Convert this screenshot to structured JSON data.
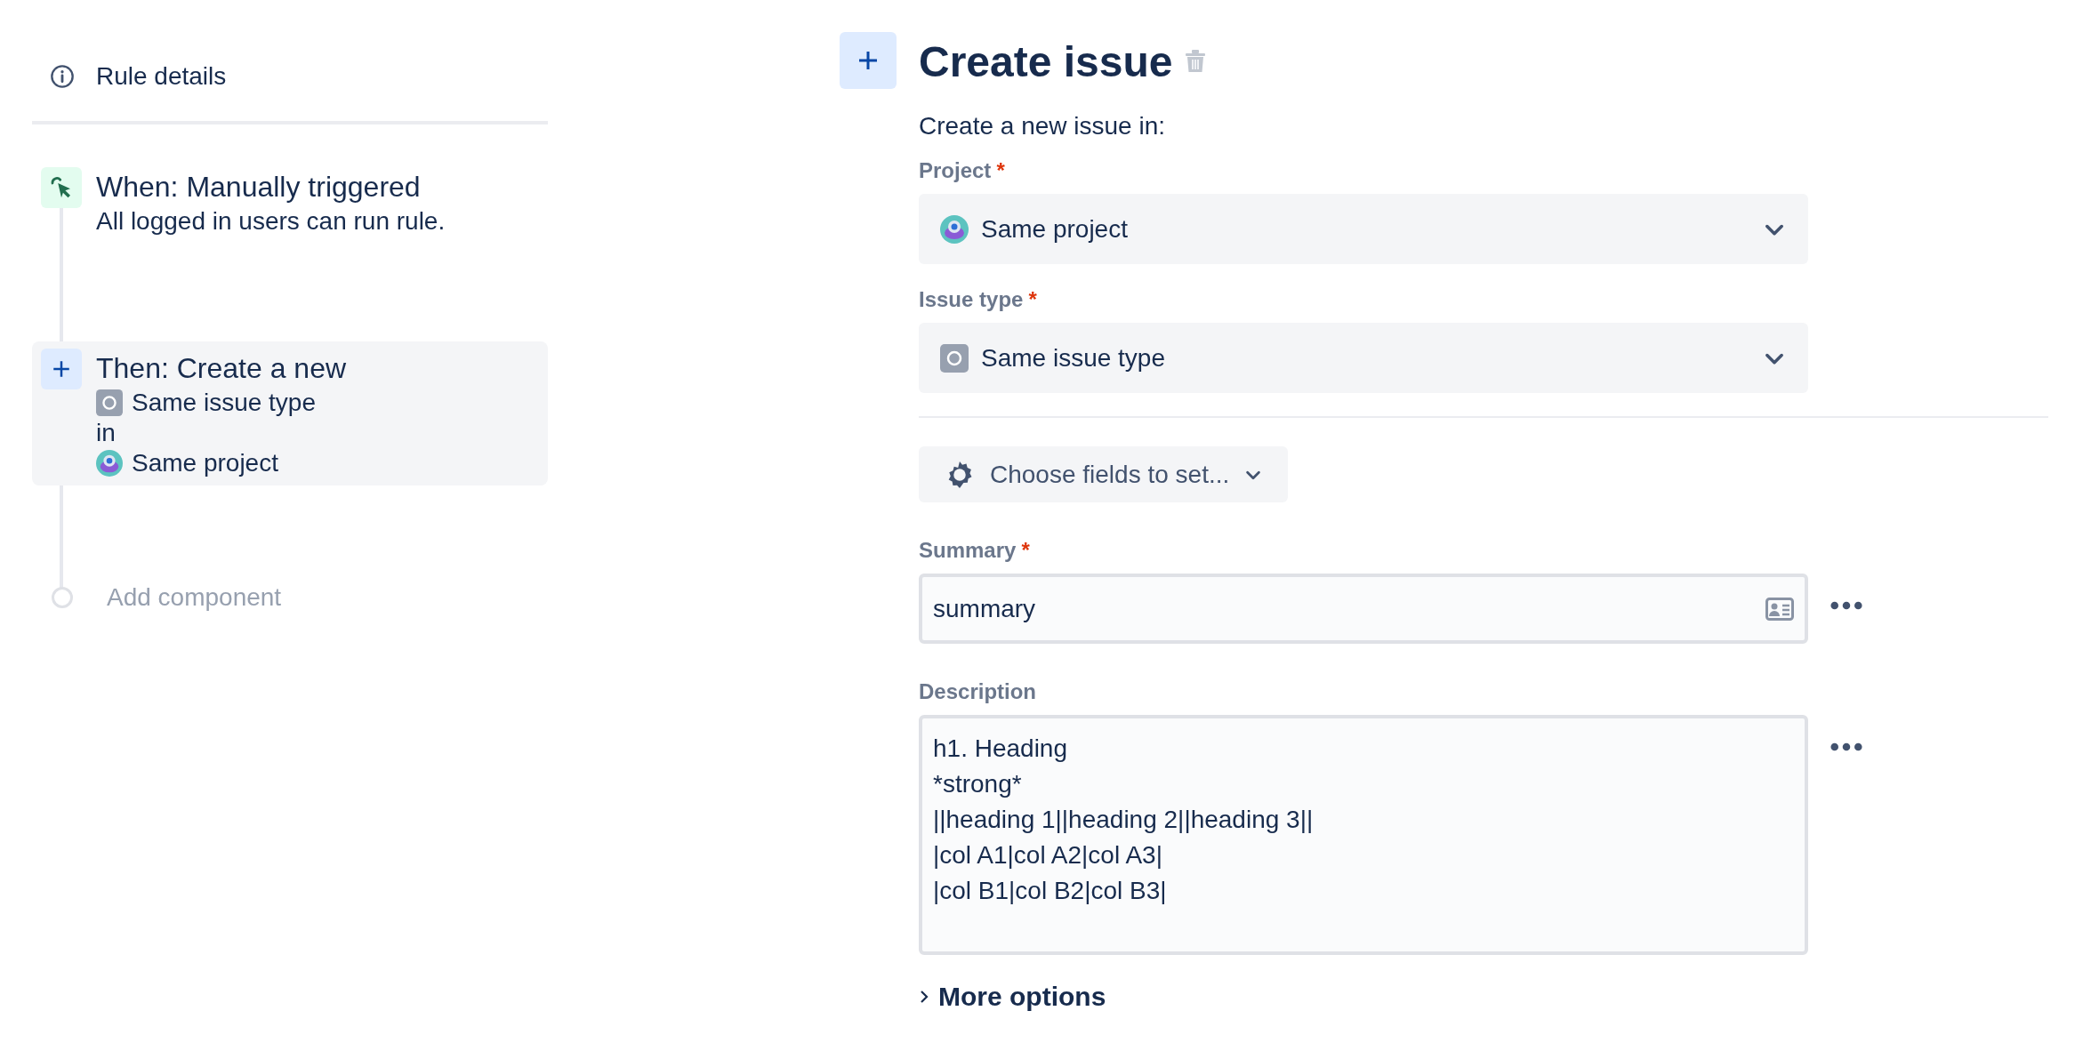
{
  "sidebar": {
    "rule_details": "Rule details",
    "steps": [
      {
        "kind": "trigger",
        "selected": false,
        "title": "When: Manually triggered",
        "lines": [
          {
            "kind": "plain",
            "text": "All logged in users can run rule."
          }
        ]
      },
      {
        "kind": "action",
        "selected": true,
        "title": "Then: Create a new",
        "lines": [
          {
            "kind": "issue-type",
            "text": "Same issue type"
          },
          {
            "kind": "plain",
            "text": "in"
          },
          {
            "kind": "project",
            "text": "Same project"
          }
        ]
      }
    ],
    "add_component": "Add component"
  },
  "panel": {
    "title": "Create issue",
    "intro": "Create a new issue in:",
    "selects": [
      {
        "kind": "project",
        "label": "Project",
        "required_mark": "*",
        "value": "Same project"
      },
      {
        "kind": "issue-type",
        "label": "Issue type",
        "required_mark": "*",
        "value": "Same issue type"
      }
    ],
    "choose_fields": "Choose fields to set...",
    "fields": [
      {
        "kind": "input",
        "label": "Summary",
        "required_mark": "*",
        "value": "summary"
      },
      {
        "kind": "textarea",
        "label": "Description",
        "value": "h1. Heading\n*strong*\n||heading 1||heading 2||heading 3||\n|col A1|col A2|col A3|\n|col B1|col B2|col B3|"
      }
    ],
    "more_options": "More options"
  }
}
